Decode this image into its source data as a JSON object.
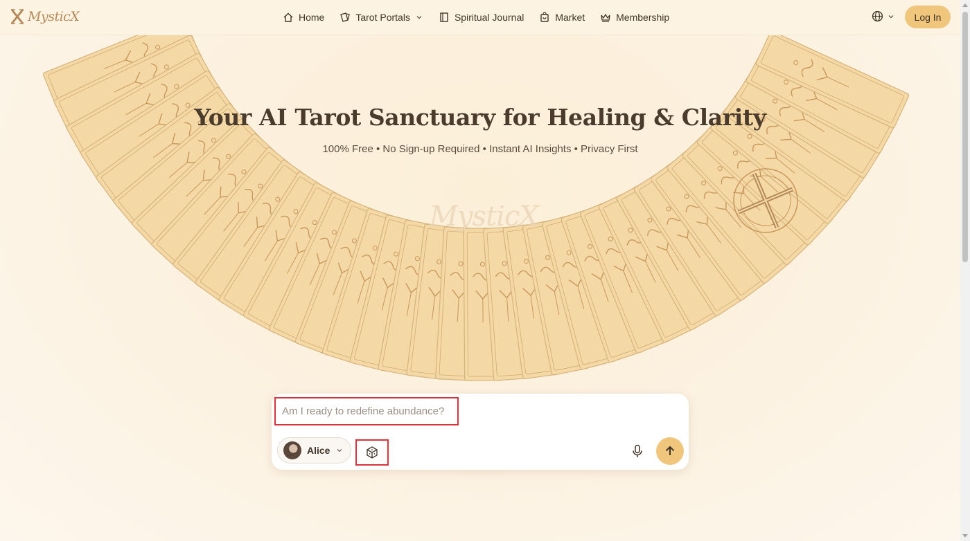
{
  "header": {
    "logo_text": "MysticX",
    "nav": [
      {
        "label": "Home",
        "icon": "home-icon"
      },
      {
        "label": "Tarot Portals",
        "icon": "tarot-card-icon"
      },
      {
        "label": "Spiritual Journal",
        "icon": "journal-icon"
      },
      {
        "label": "Market",
        "icon": "shopping-bag-icon"
      },
      {
        "label": "Membership",
        "icon": "crown-icon"
      }
    ],
    "language_icon": "globe-icon",
    "login_label": "Log In"
  },
  "hero": {
    "title": "Your AI Tarot Sanctuary for Healing & Clarity",
    "subtitle": "100% Free • No Sign-up Required • Instant AI Insights • Privacy First",
    "watermark": "MysticX"
  },
  "chat": {
    "prompt_text": "Am I ready to redefine abundance?",
    "user_name": "Alice",
    "random_icon": "dice-icon",
    "mic_icon": "microphone-icon",
    "send_icon": "arrow-up-icon"
  },
  "colors": {
    "accent": "#f0c57c",
    "card": "#f4d9a6",
    "card_ornament": "#c9965a",
    "highlight": "#d8333a",
    "text": "#4a3b2c"
  }
}
